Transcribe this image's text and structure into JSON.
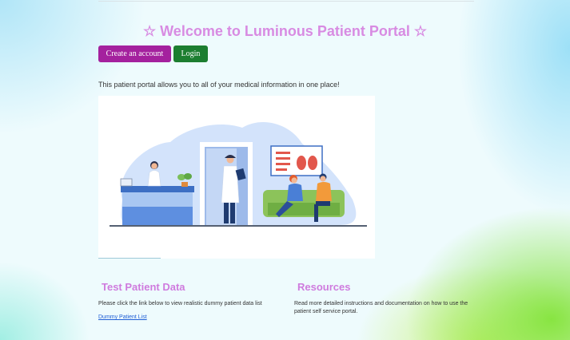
{
  "header": {
    "title": "☆ Welcome to Luminous Patient Portal ☆"
  },
  "buttons": {
    "create_account": "Create an account",
    "login": "Login"
  },
  "intro": "This patient portal allows you to all of your medical information in one place!",
  "hero_image": {
    "icon": "clinic-waiting-room-illustration"
  },
  "sections": {
    "test_data": {
      "title": "Test Patient Data",
      "text": "Please click the link below to view realistic dummy patient data list",
      "link": "Dummy Patient List"
    },
    "resources": {
      "title": "Resources",
      "text": "Read more detailed instructions and documentation on how to use the patient self service portal."
    }
  },
  "colors": {
    "title": "#d88be2",
    "create_button": "#a4219e",
    "login_button": "#1c7e30",
    "link": "#1f5fd6"
  }
}
